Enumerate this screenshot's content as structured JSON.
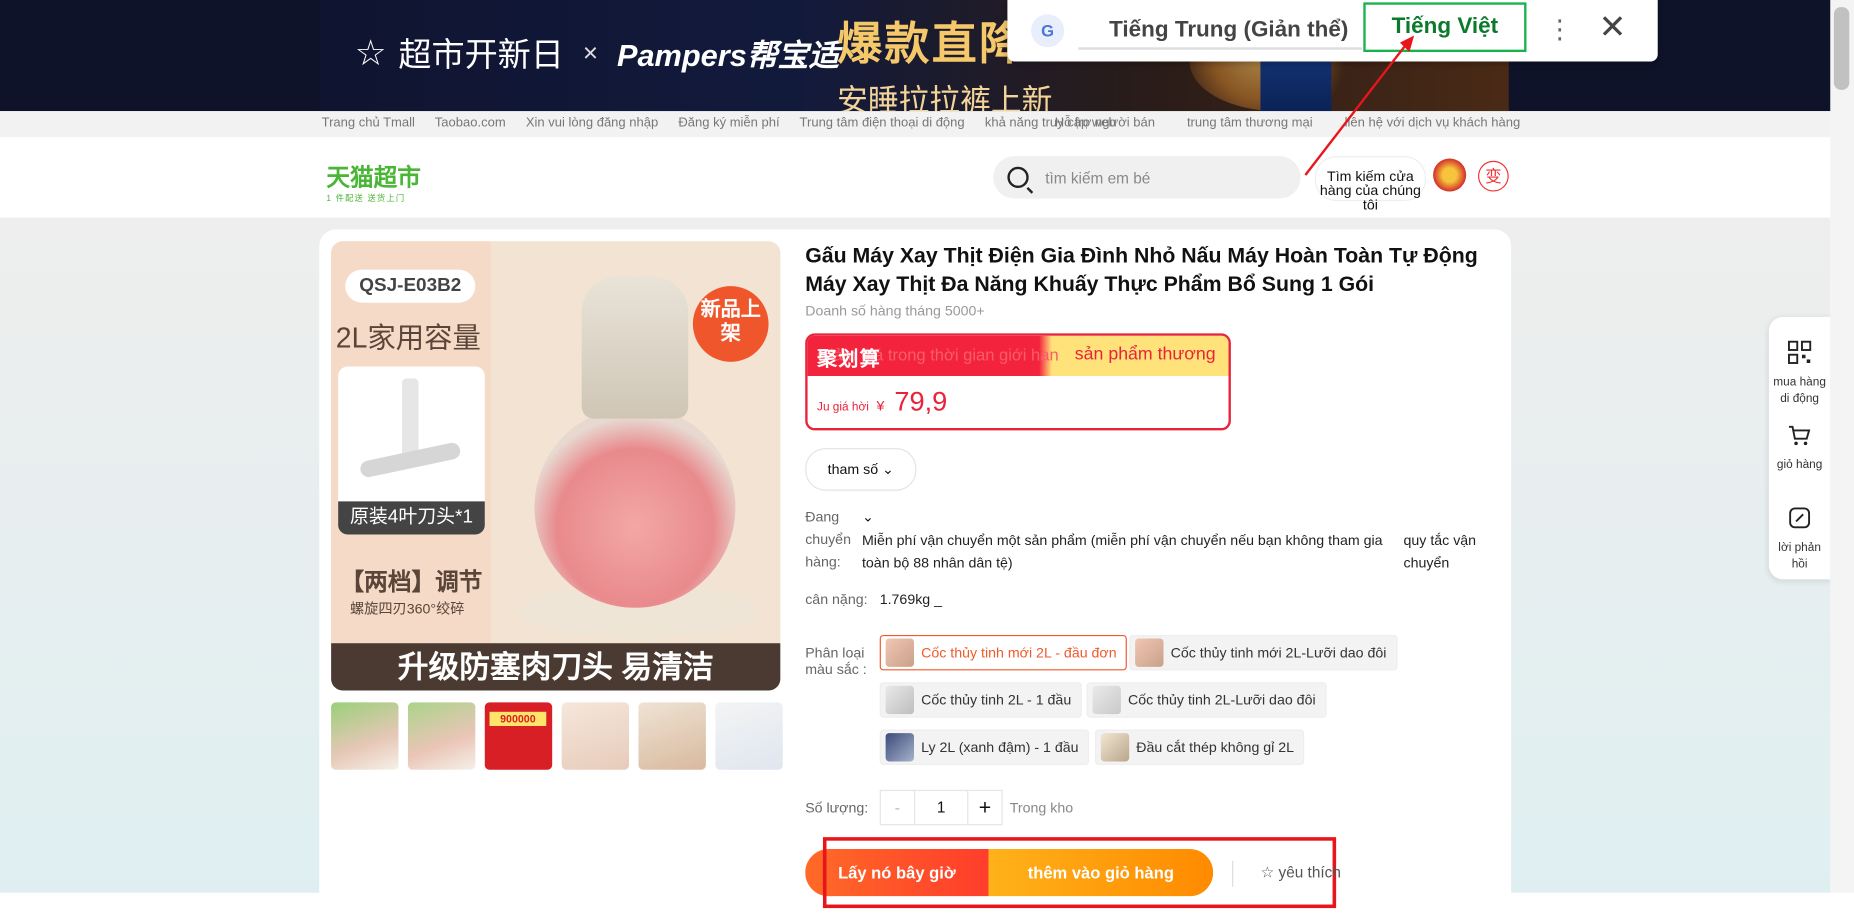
{
  "banner": {
    "left_text": "超市开新日",
    "times": "×",
    "brand": "Pampers帮宝适",
    "headline": "爆款直降",
    "subline": "安睡拉拉裤上新"
  },
  "translate": {
    "icon": "google-translate-icon",
    "source_lang": "Tiếng Trung (Giản thể)",
    "target_lang": "Tiếng Việt",
    "more": "⋮",
    "close": "✕"
  },
  "topnav": {
    "links": [
      "Trang chủ Tmall",
      "Taobao.com",
      "Xin vui lòng đăng nhập",
      "Đăng ký miễn phí",
      "Trung tâm điện thoại di động",
      "khả năng truy cập web"
    ],
    "right": [
      "Hỗ trợ người bán",
      "trung tâm thương mại",
      "liên hệ với dịch vụ khách hàng"
    ]
  },
  "header": {
    "logo": "天猫超市",
    "logo_sub": "1 件配送 送货上门",
    "search_placeholder": "tìm kiếm em bé",
    "store_search": "Tìm kiếm cửa hàng của chúng tôi",
    "change_badge": "变"
  },
  "product": {
    "image": {
      "model": "QSJ-E03B2",
      "capacity": "2L家用容量",
      "blade_caption": "原装4叶刀头*1",
      "mode": "【两档】调节",
      "mode_sub": "螺旋四刃360°绞碎",
      "tag": "新品上架",
      "bottom": "升级防塞肉刀头 易清洁"
    },
    "thumbs": [
      "thumb-1",
      "thumb-2",
      "thumb-3",
      "thumb-4",
      "thumb-5",
      "thumb-6"
    ],
    "thumb3_text": "900000",
    "title": "Gấu Máy Xay Thịt Điện Gia Đình Nhỏ Nấu Máy Hoàn Toàn Tự Động Máy Xay Thịt Đa Năng Khuấy Thực Phẩm Bổ Sung 1 Gói",
    "sales": "Doanh số hàng tháng 5000+",
    "promo": {
      "juhua": "聚划算",
      "limited": "Giảm giá trong thời gian giới hạn",
      "product_label": "sản phẩm thương",
      "price_label": "Ju giá hời",
      "currency": "¥",
      "price": "79,9"
    },
    "params_label": "tham số",
    "shipping": {
      "label": "Đang chuyển hàng:",
      "text": "Miễn phí vận chuyển một sản phẩm (miễn phí vận chuyển nếu bạn không tham gia toàn bộ 88 nhân dân tệ)",
      "rules": "quy tắc vận chuyển"
    },
    "weight": {
      "label": "cân nặng:",
      "value": "1.769kg _"
    },
    "variant_label": "Phân loại màu sắc :",
    "variants": [
      "Cốc thủy tinh mới 2L - đầu đơn",
      "Cốc thủy tinh mới 2L-Lưỡi dao đôi",
      "Cốc thủy tinh 2L - 1 đầu",
      "Cốc thủy tinh 2L-Lưỡi dao đôi",
      "Ly 2L (xanh đậm) - 1 đầu",
      "Đầu cắt thép không gỉ 2L"
    ],
    "selected_variant": "Cốc thủy tinh mới 2L - đầu đơn",
    "quantity": {
      "label": "Số lượng:",
      "minus": "-",
      "value": "1",
      "plus": "+",
      "stock": "Trong kho"
    },
    "buy_now": "Lấy nó bây giờ",
    "add_to_cart": "thêm vào giỏ hàng",
    "favorite": "yêu thích"
  },
  "floatbar": {
    "mobile": "mua hàng di động",
    "cart": "giỏ hàng",
    "feedback": "lời phản hồi"
  },
  "colors": {
    "accent": "#ff4400",
    "promo_red": "#e8233a",
    "cart_orange": "#ff9000",
    "annotation_red": "#e8151b",
    "translate_green": "#1ab24d"
  }
}
